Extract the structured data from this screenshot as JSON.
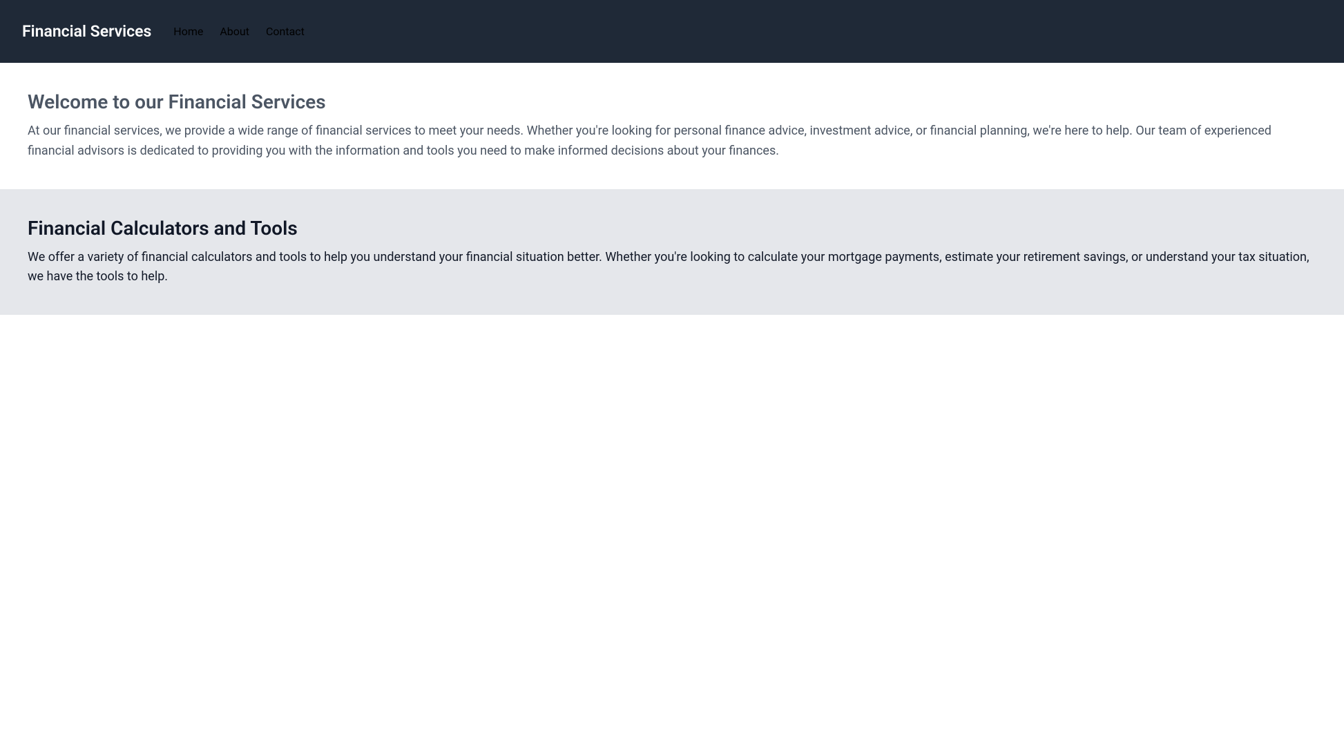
{
  "nav": {
    "brand": "Financial Services",
    "links": {
      "home": "Home",
      "about": "About",
      "contact": "Contact"
    }
  },
  "hero": {
    "title": "Welcome to our Financial Services",
    "text": "At our financial services, we provide a wide range of financial services to meet your needs. Whether you're looking for personal finance advice, investment advice, or financial planning, we're here to help. Our team of experienced financial advisors is dedicated to providing you with the information and tools you need to make informed decisions about your finances."
  },
  "tools": {
    "title": "Financial Calculators and Tools",
    "text": "We offer a variety of financial calculators and tools to help you understand your financial situation better. Whether you're looking to calculate your mortgage payments, estimate your retirement savings, or understand your tax situation, we have the tools to help."
  }
}
